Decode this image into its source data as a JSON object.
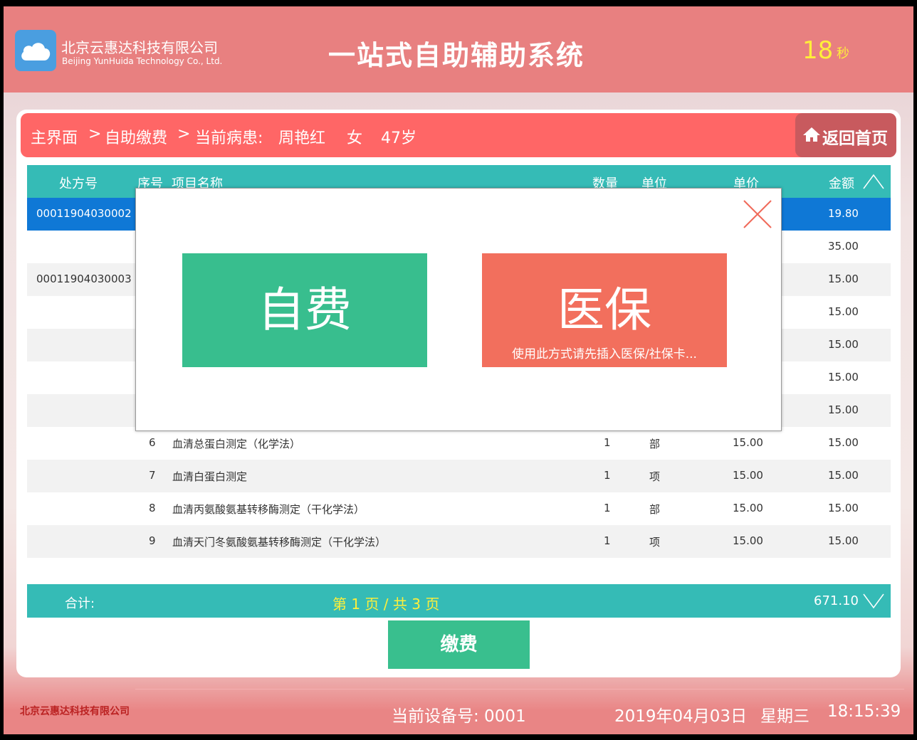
{
  "header": {
    "company_cn": "北京云惠达科技有限公司",
    "company_en": "Beijing YunHuida Technology Co., Ltd.",
    "title": "一站式自助辅助系统",
    "countdown": "18",
    "countdown_unit": "秒"
  },
  "breadcrumb": {
    "home": "主界面",
    "sep1": ">",
    "page": "自助缴费",
    "sep2": ">",
    "patient_label": "当前病患:",
    "patient_name": "周艳红",
    "patient_gender": "女",
    "patient_age": "47岁",
    "home_button": "返回首页"
  },
  "table": {
    "columns": {
      "rx_no": "处方号",
      "seq": "序号",
      "item": "项目名称",
      "qty": "数量",
      "unit": "单位",
      "price": "单价",
      "amount": "金额"
    },
    "rows": [
      {
        "rx_no": "00011904030002",
        "seq": "",
        "item": "",
        "qty": "",
        "unit": "",
        "price": "",
        "amount": "19.80"
      },
      {
        "rx_no": "",
        "seq": "",
        "item": "",
        "qty": "",
        "unit": "",
        "price": "",
        "amount": "35.00"
      },
      {
        "rx_no": "00011904030003",
        "seq": "",
        "item": "",
        "qty": "",
        "unit": "",
        "price": "",
        "amount": "15.00"
      },
      {
        "rx_no": "",
        "seq": "",
        "item": "",
        "qty": "",
        "unit": "",
        "price": "",
        "amount": "15.00"
      },
      {
        "rx_no": "",
        "seq": "",
        "item": "",
        "qty": "",
        "unit": "",
        "price": "",
        "amount": "15.00"
      },
      {
        "rx_no": "",
        "seq": "",
        "item": "",
        "qty": "",
        "unit": "",
        "price": "",
        "amount": "15.00"
      },
      {
        "rx_no": "",
        "seq": "",
        "item": "",
        "qty": "",
        "unit": "",
        "price": "",
        "amount": "15.00"
      },
      {
        "rx_no": "",
        "seq": "6",
        "item": "血清总蛋白测定（化学法）",
        "qty": "1",
        "unit": "部",
        "price": "15.00",
        "amount": "15.00"
      },
      {
        "rx_no": "",
        "seq": "7",
        "item": "血清白蛋白测定",
        "qty": "1",
        "unit": "项",
        "price": "15.00",
        "amount": "15.00"
      },
      {
        "rx_no": "",
        "seq": "8",
        "item": "血清丙氨酸氨基转移酶测定（干化学法）",
        "qty": "1",
        "unit": "部",
        "price": "15.00",
        "amount": "15.00"
      },
      {
        "rx_no": "",
        "seq": "9",
        "item": "血清天门冬氨酸氨基转移酶测定（干化学法）",
        "qty": "1",
        "unit": "项",
        "price": "15.00",
        "amount": "15.00"
      }
    ],
    "footer": {
      "total_label": "合计:",
      "pagination": "第 1 页 / 共 3 页",
      "total": "671.10"
    }
  },
  "pay_button": "缴费",
  "modal": {
    "self_pay": "自费",
    "insurance": "医保",
    "insurance_hint": "使用此方式请先插入医保/社保卡..."
  },
  "status_bar": {
    "company": "北京云惠达科技有限公司",
    "device": "当前设备号: 0001",
    "date": "2019年04月03日",
    "weekday": "星期三",
    "time": "18:15:39"
  },
  "colors": {
    "header_bg": "#e88080",
    "breadcrumb_bg": "#ff6666",
    "table_teal": "#35bbb6",
    "selected_row": "#0f78d6",
    "self_pay_green": "#38be8e",
    "insurance_orange": "#f26f5d",
    "countdown_yellow": "#ffef3a"
  }
}
